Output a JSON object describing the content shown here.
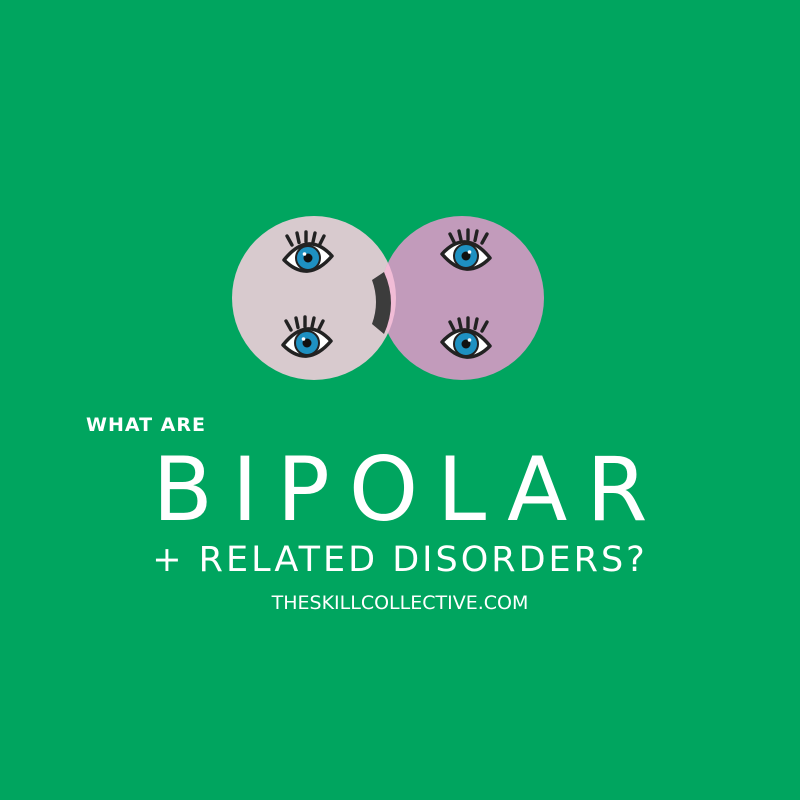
{
  "colors": {
    "background": "#00a55f",
    "left_circle": "#d8cace",
    "right_circle": "#c29bbb",
    "overlap": "#f1bcd6",
    "mouth": "#3c3c3c",
    "iris": "#1e90c1",
    "outline": "#222222",
    "text": "#ffffff"
  },
  "illustration": {
    "eye_icon": "eye-icon",
    "mouth_icon": "crescent-mouth-icon"
  },
  "text": {
    "kicker": "WHAT ARE",
    "headline": "BIPOLAR",
    "subline": "+ RELATED DISORDERS?",
    "website": "THESKILLCOLLECTIVE.COM"
  }
}
